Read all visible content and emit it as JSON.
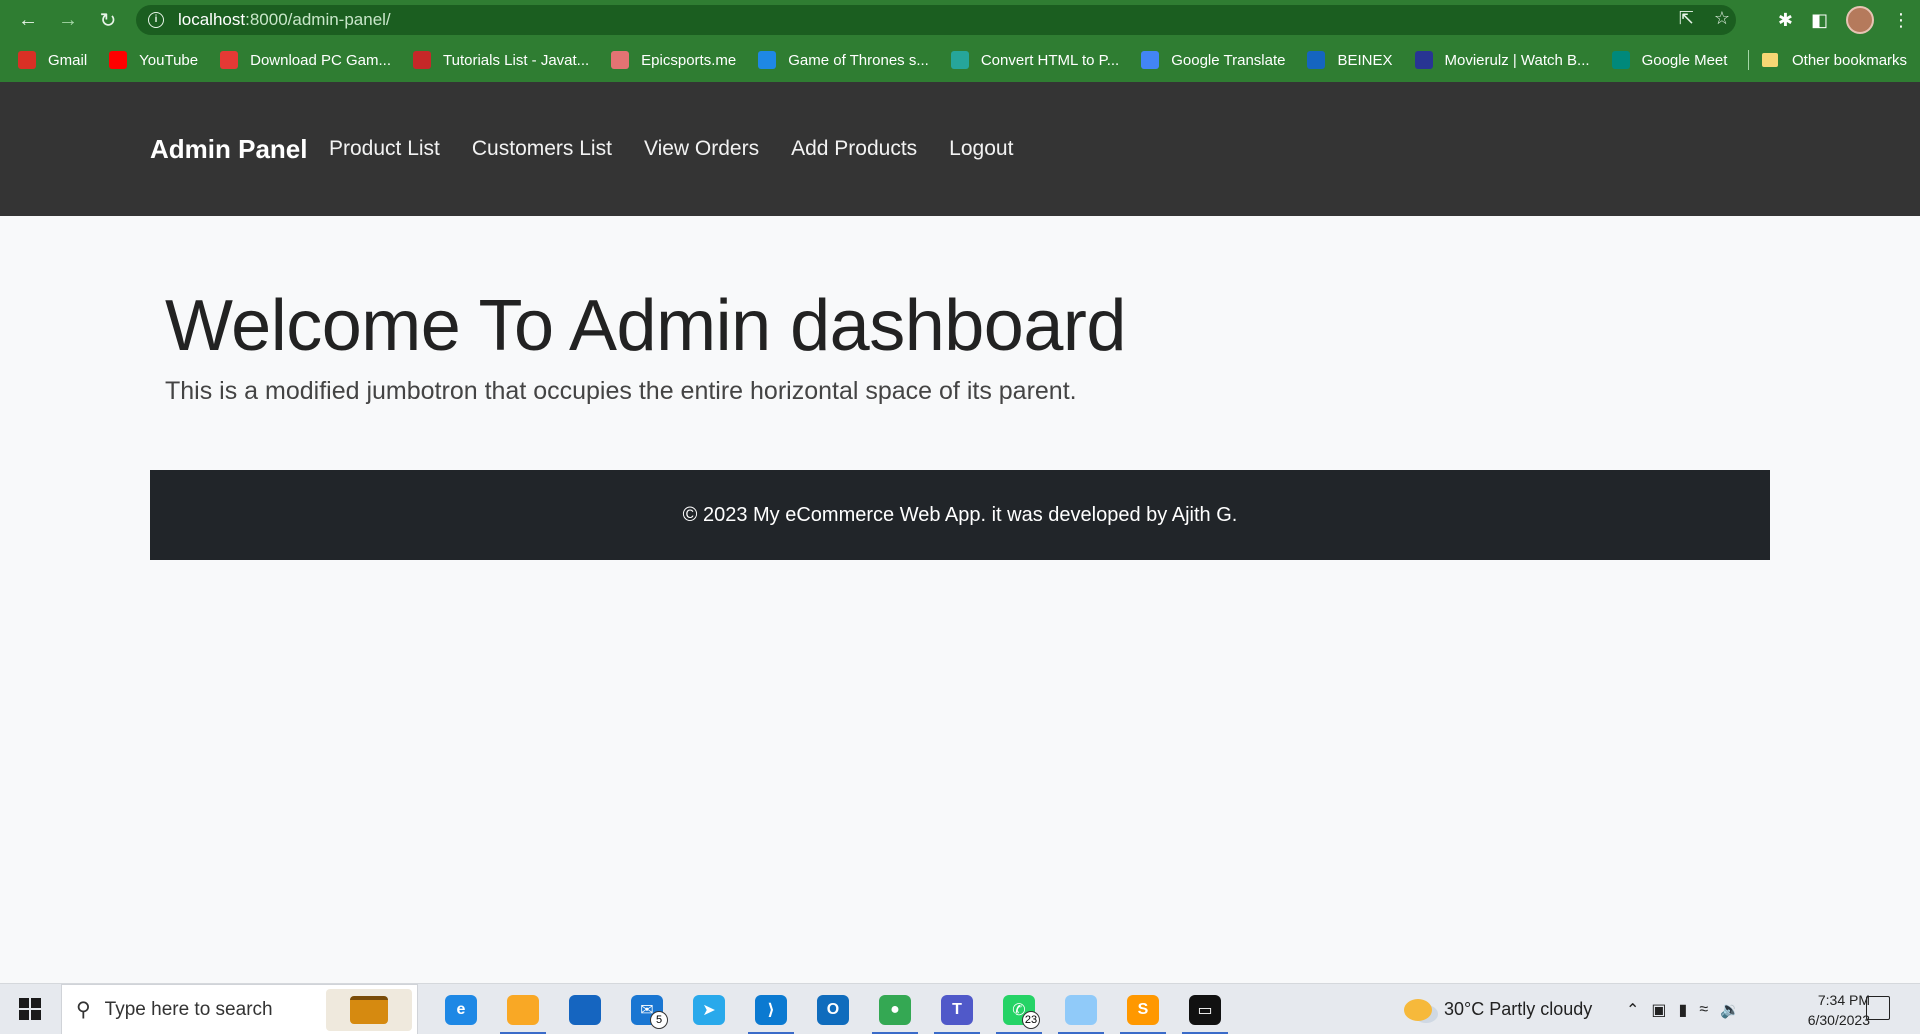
{
  "browser": {
    "url_host": "localhost",
    "url_rest": ":8000/admin-panel/",
    "bookmarks": [
      {
        "label": "Gmail",
        "color": "#d93025"
      },
      {
        "label": "YouTube",
        "color": "#ff0000"
      },
      {
        "label": "Download PC Gam...",
        "color": "#e53935"
      },
      {
        "label": "Tutorials List - Javat...",
        "color": "#c62828"
      },
      {
        "label": "Epicsports.me",
        "color": "#e57373"
      },
      {
        "label": "Game of Thrones s...",
        "color": "#1e88e5"
      },
      {
        "label": "Convert HTML to P...",
        "color": "#26a69a"
      },
      {
        "label": "Google Translate",
        "color": "#4285f4"
      },
      {
        "label": "BEINEX",
        "color": "#1565c0"
      },
      {
        "label": "Movierulz | Watch B...",
        "color": "#283593"
      },
      {
        "label": "Google Meet",
        "color": "#00897b"
      }
    ],
    "other_bookmarks": "Other bookmarks"
  },
  "navbar": {
    "brand": "Admin Panel",
    "links": [
      "Product List",
      "Customers List",
      "View Orders",
      "Add Products",
      "Logout"
    ]
  },
  "jumbotron": {
    "title": "Welcome To Admin dashboard",
    "lead": "This is a modified jumbotron that occupies the entire horizontal space of its parent."
  },
  "footer": {
    "text": "© 2023 My eCommerce Web App. it was developed by Ajith G."
  },
  "taskbar": {
    "search_placeholder": "Type here to search",
    "apps": [
      {
        "name": "edge-icon",
        "color": "#1e88e5",
        "glyph": "e",
        "active": false,
        "badge": ""
      },
      {
        "name": "file-explorer-icon",
        "color": "#f9a825",
        "glyph": "",
        "active": true,
        "badge": ""
      },
      {
        "name": "store-icon",
        "color": "#1565c0",
        "glyph": "",
        "active": false,
        "badge": ""
      },
      {
        "name": "mail-icon",
        "color": "#1976d2",
        "glyph": "✉",
        "active": false,
        "badge": "5"
      },
      {
        "name": "telegram-icon",
        "color": "#29a9eb",
        "glyph": "➤",
        "active": false,
        "badge": ""
      },
      {
        "name": "vscode-icon",
        "color": "#0b7ad1",
        "glyph": "⟩",
        "active": true,
        "badge": ""
      },
      {
        "name": "outlook-icon",
        "color": "#0f6cbd",
        "glyph": "O",
        "active": false,
        "badge": ""
      },
      {
        "name": "chrome-icon",
        "color": "#34a853",
        "glyph": "●",
        "active": true,
        "badge": ""
      },
      {
        "name": "teams-icon",
        "color": "#5059c9",
        "glyph": "T",
        "active": true,
        "badge": ""
      },
      {
        "name": "whatsapp-icon",
        "color": "#25d366",
        "glyph": "✆",
        "active": true,
        "badge": "23"
      },
      {
        "name": "notes-icon",
        "color": "#90caf9",
        "glyph": "",
        "active": true,
        "badge": ""
      },
      {
        "name": "sublime-icon",
        "color": "#ff9800",
        "glyph": "S",
        "active": true,
        "badge": ""
      },
      {
        "name": "terminal-icon",
        "color": "#111111",
        "glyph": "▭",
        "active": true,
        "badge": ""
      }
    ],
    "weather": "30°C  Partly cloudy",
    "time": "7:34 PM",
    "date": "6/30/2023"
  }
}
